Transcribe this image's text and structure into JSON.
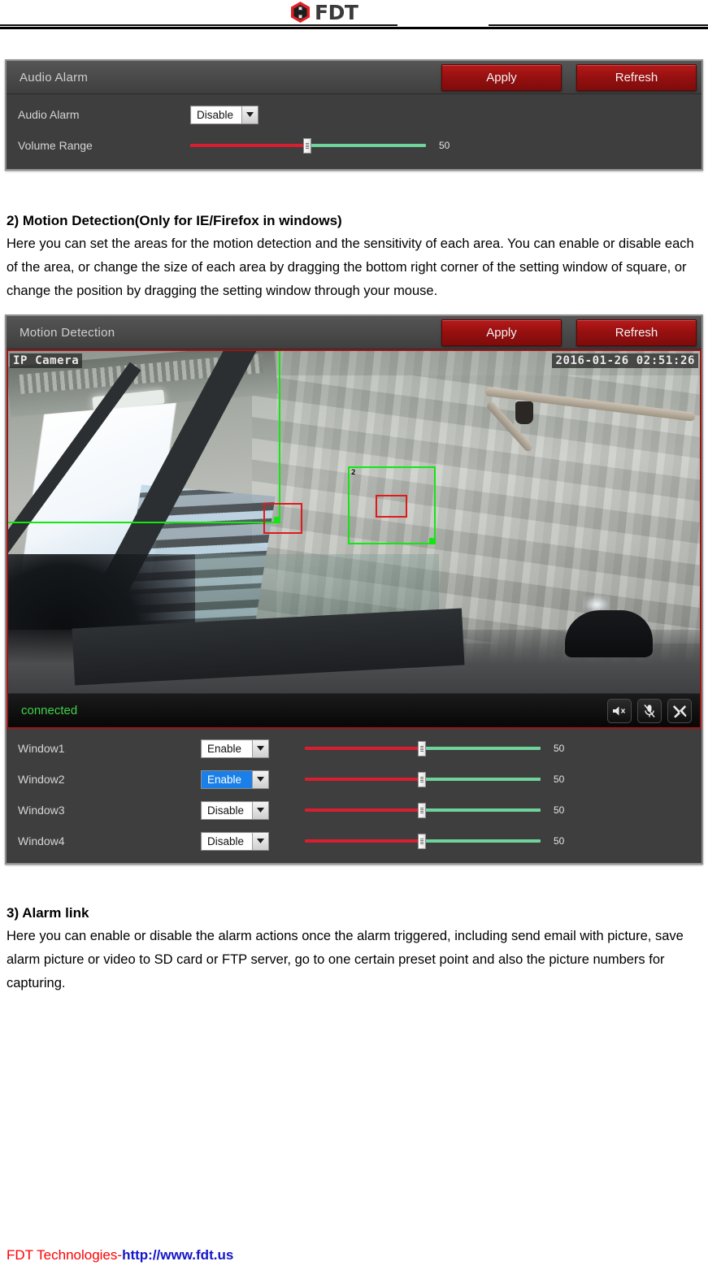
{
  "header": {
    "logo_icon": "fdt-hexagon-logo-icon",
    "logo_text": "FDT"
  },
  "audio_alarm_panel": {
    "title": "Audio Alarm",
    "apply_label": "Apply",
    "refresh_label": "Refresh",
    "rows": [
      {
        "label": "Audio Alarm",
        "control": "select",
        "value": "Disable"
      },
      {
        "label": "Volume Range",
        "control": "slider",
        "value": "50"
      }
    ]
  },
  "section_motion": {
    "title": "2) Motion Detection(Only for IE/Firefox in windows)",
    "body": "Here you can set the areas for the motion detection and the sensitivity of each area. You can enable or disable each of the area, or change the size of each area by dragging the bottom right corner of the setting window of square, or change the position by dragging the setting window through your mouse."
  },
  "motion_panel": {
    "title": "Motion Detection",
    "apply_label": "Apply",
    "refresh_label": "Refresh",
    "video": {
      "camera_name": "IP Camera",
      "timestamp": "2016-01-26 02:51:26",
      "status": "connected",
      "tools": [
        {
          "icon": "speaker-mute-icon"
        },
        {
          "icon": "microphone-mute-icon"
        },
        {
          "icon": "tools-wrench-icon"
        }
      ]
    },
    "windows": [
      {
        "label": "Window1",
        "value": "Enable",
        "focused": false,
        "sensitivity": "50"
      },
      {
        "label": "Window2",
        "value": "Enable",
        "focused": true,
        "sensitivity": "50"
      },
      {
        "label": "Window3",
        "value": "Disable",
        "focused": false,
        "sensitivity": "50"
      },
      {
        "label": "Window4",
        "value": "Disable",
        "focused": false,
        "sensitivity": "50"
      }
    ]
  },
  "section_alarm": {
    "title": "3) Alarm link",
    "body": "Here you can enable or disable the alarm actions once the alarm triggered, including send email with picture, save alarm picture or video to SD card or FTP server, go to one certain preset point and also the picture numbers for capturing."
  },
  "footer": {
    "company": "FDT Technologies-",
    "url": "http://www.fdt.us"
  },
  "colors": {
    "brand_red": "#e21e26",
    "button_red": "#981010",
    "panel_dark": "#3e3e3e",
    "slider_left": "#d81e31",
    "slider_right": "#6fd49b",
    "status_green": "#3fd24a",
    "motion_box_green": "#12e712",
    "motion_resize_red": "#e01a1a",
    "footer_red": "#ff0000",
    "footer_blue": "#1414c8"
  }
}
